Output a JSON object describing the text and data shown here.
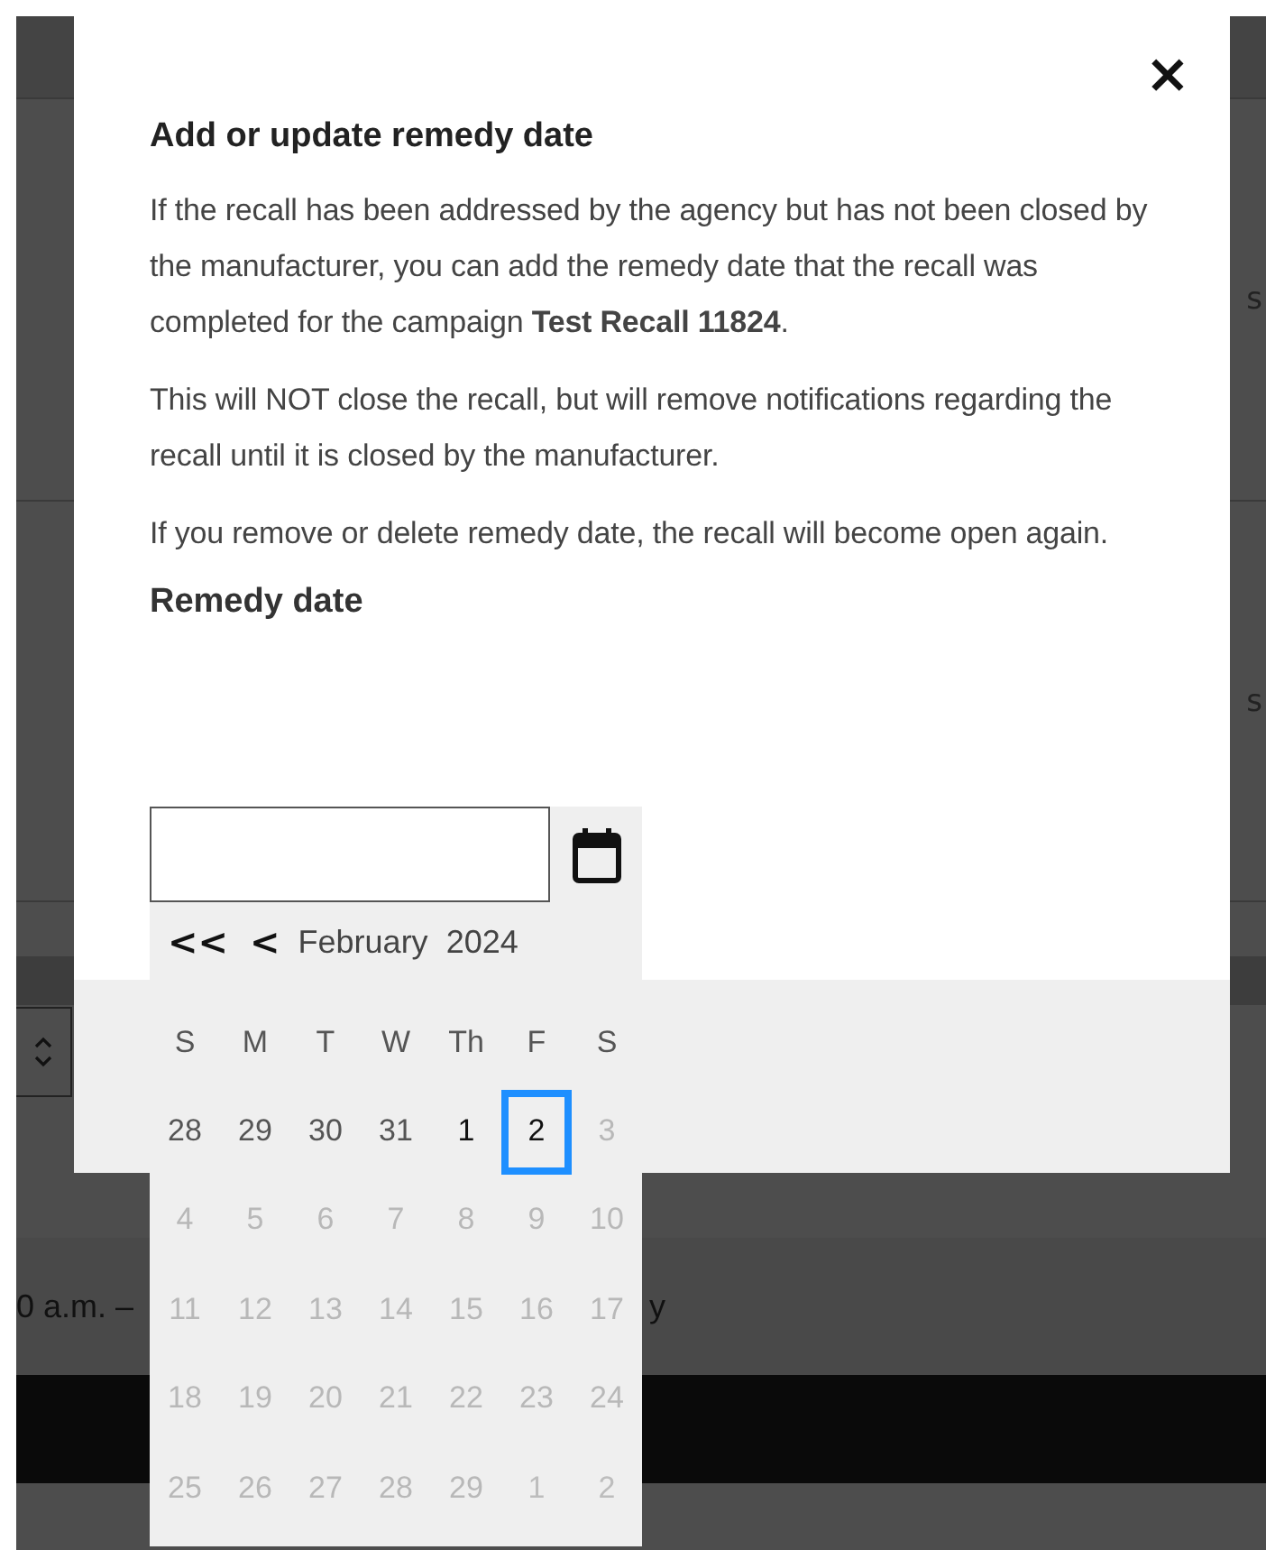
{
  "background": {
    "side_texts": [
      "s",
      "s"
    ],
    "time_text": "0 a.m. –",
    "trailing_text": "y"
  },
  "dialog": {
    "title": "Add or update remedy date",
    "close": "×",
    "paragraphs": [
      "If the recall has been addressed by the agency but has not been closed by the manufacturer, you can add the remedy date that the recall was completed for the campaign **Test Recall 11824**.",
      "This will NOT close the recall, but will remove notifications regarding the recall until it is closed by the manufacturer.",
      "If you remove or delete remedy date, the recall will become open again."
    ],
    "field_label": "Remedy date"
  },
  "calendar": {
    "prev_year": "<<",
    "prev_month": "<",
    "month": "February",
    "year": "2024",
    "weekdays": [
      "S",
      "M",
      "T",
      "W",
      "Th",
      "F",
      "S"
    ],
    "days": [
      {
        "label": "28",
        "outside": true,
        "disabled": false,
        "selected": false
      },
      {
        "label": "29",
        "outside": true,
        "disabled": false,
        "selected": false
      },
      {
        "label": "30",
        "outside": true,
        "disabled": false,
        "selected": false
      },
      {
        "label": "31",
        "outside": true,
        "disabled": false,
        "selected": false
      },
      {
        "label": "1",
        "outside": false,
        "disabled": false,
        "selected": false
      },
      {
        "label": "2",
        "outside": false,
        "disabled": false,
        "selected": true
      },
      {
        "label": "3",
        "outside": false,
        "disabled": true,
        "selected": false
      },
      {
        "label": "4",
        "outside": false,
        "disabled": true,
        "selected": false
      },
      {
        "label": "5",
        "outside": false,
        "disabled": true,
        "selected": false
      },
      {
        "label": "6",
        "outside": false,
        "disabled": true,
        "selected": false
      },
      {
        "label": "7",
        "outside": false,
        "disabled": true,
        "selected": false
      },
      {
        "label": "8",
        "outside": false,
        "disabled": true,
        "selected": false
      },
      {
        "label": "9",
        "outside": false,
        "disabled": true,
        "selected": false
      },
      {
        "label": "10",
        "outside": false,
        "disabled": true,
        "selected": false
      },
      {
        "label": "11",
        "outside": false,
        "disabled": true,
        "selected": false
      },
      {
        "label": "12",
        "outside": false,
        "disabled": true,
        "selected": false
      },
      {
        "label": "13",
        "outside": false,
        "disabled": true,
        "selected": false
      },
      {
        "label": "14",
        "outside": false,
        "disabled": true,
        "selected": false
      },
      {
        "label": "15",
        "outside": false,
        "disabled": true,
        "selected": false
      },
      {
        "label": "16",
        "outside": false,
        "disabled": true,
        "selected": false
      },
      {
        "label": "17",
        "outside": false,
        "disabled": true,
        "selected": false
      },
      {
        "label": "18",
        "outside": false,
        "disabled": true,
        "selected": false
      },
      {
        "label": "19",
        "outside": false,
        "disabled": true,
        "selected": false
      },
      {
        "label": "20",
        "outside": false,
        "disabled": true,
        "selected": false
      },
      {
        "label": "21",
        "outside": false,
        "disabled": true,
        "selected": false
      },
      {
        "label": "22",
        "outside": false,
        "disabled": true,
        "selected": false
      },
      {
        "label": "23",
        "outside": false,
        "disabled": true,
        "selected": false
      },
      {
        "label": "24",
        "outside": false,
        "disabled": true,
        "selected": false
      },
      {
        "label": "25",
        "outside": false,
        "disabled": true,
        "selected": false
      },
      {
        "label": "26",
        "outside": false,
        "disabled": true,
        "selected": false
      },
      {
        "label": "27",
        "outside": false,
        "disabled": true,
        "selected": false
      },
      {
        "label": "28",
        "outside": false,
        "disabled": true,
        "selected": false
      },
      {
        "label": "29",
        "outside": false,
        "disabled": true,
        "selected": false
      },
      {
        "label": "1",
        "outside": true,
        "disabled": true,
        "selected": false
      },
      {
        "label": "2",
        "outside": true,
        "disabled": true,
        "selected": false
      }
    ]
  }
}
